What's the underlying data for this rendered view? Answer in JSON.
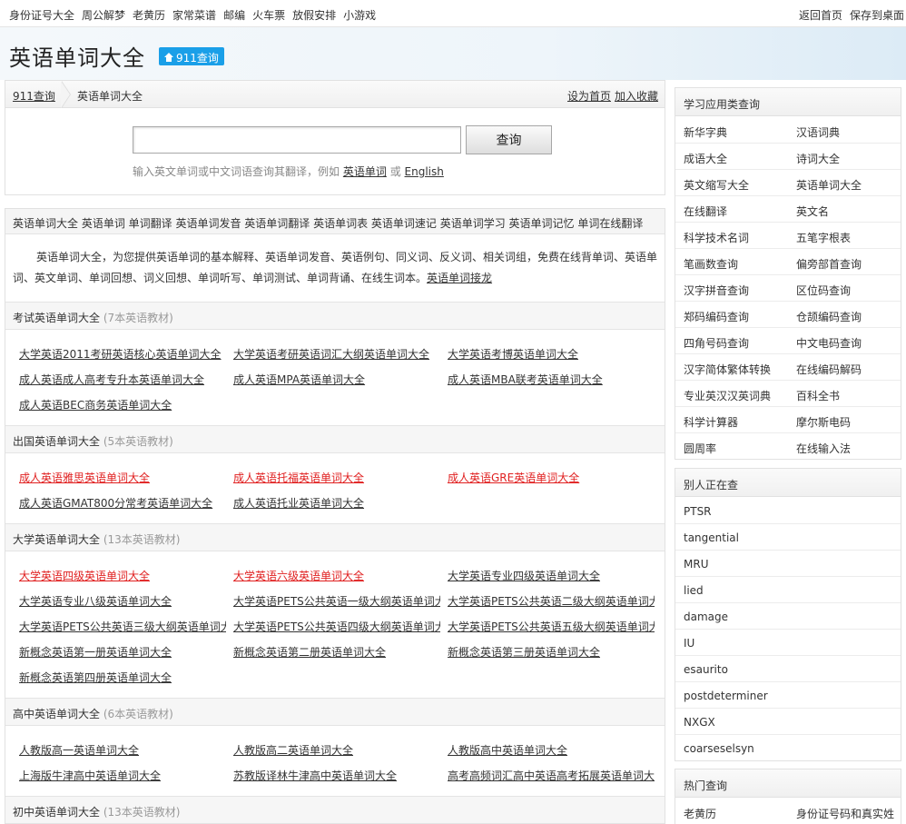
{
  "topbar": {
    "left": [
      "身份证号大全",
      "周公解梦",
      "老黄历",
      "家常菜谱",
      "邮编",
      "火车票",
      "放假安排",
      "小游戏"
    ],
    "right": [
      "返回首页",
      "保存到桌面"
    ]
  },
  "site": {
    "title": "英语单词大全",
    "badge": "911查询"
  },
  "crumb": {
    "home": "911查询",
    "current": "英语单词大全",
    "set_home": "设为首页",
    "favorite": "加入收藏"
  },
  "search": {
    "button": "查询",
    "hint_prefix": "输入英文单词或中文词语查询其翻译，例如",
    "example1": "英语单词",
    "or": "或",
    "example2": "English"
  },
  "tags": "英语单词大全 英语单词 单词翻译 英语单词发音 英语单词翻译 英语单词表 英语单词速记 英语单词学习 英语单词记忆 单词在线翻译",
  "intro": {
    "text": "英语单词大全，为您提供英语单词的基本解释、英语单词发音、英语例句、同义词、反义词、相关词组，免费在线背单词、英语单词、英文单词、单词回想、词义回想、单词听写、单词测试、单词背诵、在线生词本。",
    "link": "英语单词接龙"
  },
  "sections": [
    {
      "title": "考试英语单词大全",
      "count": "(7本英语教材)",
      "links": [
        {
          "t": "大学英语2011考研英语核心英语单词大全",
          "red": false
        },
        {
          "t": "大学英语考研英语词汇大纲英语单词大全",
          "red": false
        },
        {
          "t": "大学英语考博英语单词大全",
          "red": false
        },
        {
          "t": "成人英语成人高考专升本英语单词大全",
          "red": false
        },
        {
          "t": "成人英语MPA英语单词大全",
          "red": false
        },
        {
          "t": "成人英语MBA联考英语单词大全",
          "red": false
        },
        {
          "t": "成人英语BEC商务英语单词大全",
          "red": false
        }
      ]
    },
    {
      "title": "出国英语单词大全",
      "count": "(5本英语教材)",
      "links": [
        {
          "t": "成人英语雅思英语单词大全",
          "red": true
        },
        {
          "t": "成人英语托福英语单词大全",
          "red": true
        },
        {
          "t": "成人英语GRE英语单词大全",
          "red": true
        },
        {
          "t": "成人英语GMAT800分常考英语单词大全",
          "red": false
        },
        {
          "t": "成人英语托业英语单词大全",
          "red": false
        }
      ]
    },
    {
      "title": "大学英语单词大全",
      "count": "(13本英语教材)",
      "links": [
        {
          "t": "大学英语四级英语单词大全",
          "red": true
        },
        {
          "t": "大学英语六级英语单词大全",
          "red": true
        },
        {
          "t": "大学英语专业四级英语单词大全",
          "red": false
        },
        {
          "t": "大学英语专业八级英语单词大全",
          "red": false
        },
        {
          "t": "大学英语PETS公共英语一级大纲英语单词大全",
          "red": false
        },
        {
          "t": "大学英语PETS公共英语二级大纲英语单词大全",
          "red": false
        },
        {
          "t": "大学英语PETS公共英语三级大纲英语单词大全",
          "red": false
        },
        {
          "t": "大学英语PETS公共英语四级大纲英语单词大全",
          "red": false
        },
        {
          "t": "大学英语PETS公共英语五级大纲英语单词大全",
          "red": false
        },
        {
          "t": "新概念英语第一册英语单词大全",
          "red": false
        },
        {
          "t": "新概念英语第二册英语单词大全",
          "red": false
        },
        {
          "t": "新概念英语第三册英语单词大全",
          "red": false
        },
        {
          "t": "新概念英语第四册英语单词大全",
          "red": false
        }
      ]
    },
    {
      "title": "高中英语单词大全",
      "count": "(6本英语教材)",
      "links": [
        {
          "t": "人教版高一英语单词大全",
          "red": false
        },
        {
          "t": "人教版高二英语单词大全",
          "red": false
        },
        {
          "t": "人教版高中英语单词大全",
          "red": false
        },
        {
          "t": "上海版牛津高中英语单词大全",
          "red": false
        },
        {
          "t": "苏教版译林牛津高中英语单词大全",
          "red": false
        },
        {
          "t": "高考高频词汇高中英语高考拓展英语单词大全",
          "red": false
        }
      ]
    },
    {
      "title": "初中英语单词大全",
      "count": "(13本英语教材)",
      "links": []
    }
  ],
  "side_study": {
    "title": "学习应用类查询",
    "rows": [
      [
        "新华字典",
        "汉语词典"
      ],
      [
        "成语大全",
        "诗词大全"
      ],
      [
        "英文缩写大全",
        "英语单词大全"
      ],
      [
        "在线翻译",
        "英文名"
      ],
      [
        "科学技术名词",
        "五笔字根表"
      ],
      [
        "笔画数查询",
        "偏旁部首查询"
      ],
      [
        "汉字拼音查询",
        "区位码查询"
      ],
      [
        "郑码编码查询",
        "仓颉编码查询"
      ],
      [
        "四角号码查询",
        "中文电码查询"
      ],
      [
        "汉字简体繁体转换",
        "在线编码解码"
      ],
      [
        "专业英汉汉英词典",
        "百科全书"
      ],
      [
        "科学计算器",
        "摩尔斯电码"
      ],
      [
        "圆周率",
        "在线输入法"
      ]
    ]
  },
  "side_others": {
    "title": "别人正在查",
    "items": [
      "PTSR",
      "tangential",
      "MRU",
      "lied",
      "damage",
      "IU",
      "esaurito",
      "postdeterminer",
      "NXGX",
      "coarseselsyn"
    ]
  },
  "side_hot": {
    "title": "热门查询",
    "rows": [
      [
        "老黄历",
        "身份证号码和真实姓"
      ]
    ]
  }
}
